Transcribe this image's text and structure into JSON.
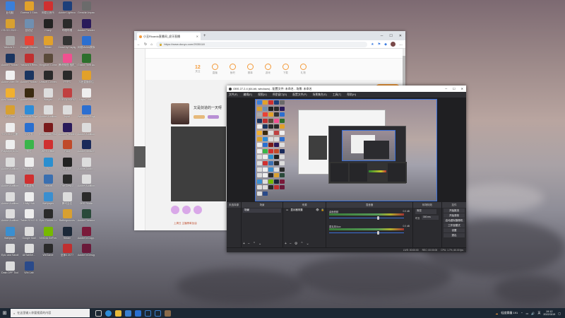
{
  "desktop_icons": [
    {
      "label": "此电脑",
      "color": "#3b7fd9"
    },
    {
      "label": "Garena 3 Global Off...",
      "color": "#e2a12a"
    },
    {
      "label": "网易云音乐",
      "color": "#d03030"
    },
    {
      "label": "Adobe Lightroom...",
      "color": "#1d3f7a"
    },
    {
      "label": "Genshin Impact",
      "color": "#6b6b6b"
    },
    {
      "label": "CS:GO 2022...",
      "color": "#d8a030"
    },
    {
      "label": "",
      "color": "transparent"
    },
    {
      "label": "",
      "color": "transparent"
    },
    {
      "label": "",
      "color": "transparent"
    },
    {
      "label": "",
      "color": "transparent"
    },
    {
      "label": "回收站",
      "color": "#6f8fb0"
    },
    {
      "label": "Crazy",
      "color": "#222"
    },
    {
      "label": "哔哩哔哩",
      "color": "#2a2a2a"
    },
    {
      "label": "Adobe Premier...",
      "color": "#2a1a5a"
    },
    {
      "label": "Yakuza 3...",
      "color": "#aaa"
    },
    {
      "label": "Google Chrome",
      "color": "#e94235"
    },
    {
      "label": "",
      "color": "transparent"
    },
    {
      "label": "",
      "color": "transparent"
    },
    {
      "label": "",
      "color": "transparent"
    },
    {
      "label": "",
      "color": "transparent"
    },
    {
      "label": "Steam",
      "color": "#e2a12a"
    },
    {
      "label": "Dead by Daylight",
      "color": "#333"
    },
    {
      "label": "网易MuMu模拟器",
      "color": "#2c6fd0"
    },
    {
      "label": "Adobe Photosh...",
      "color": "#1b3560"
    },
    {
      "label": "Yakuza 5 Remaster...",
      "color": "#c03030"
    },
    {
      "label": "Kingdom Come...",
      "color": "#5a4a3a"
    },
    {
      "label": "",
      "color": "transparent"
    },
    {
      "label": "",
      "color": "transparent"
    },
    {
      "label": "",
      "color": "transparent"
    },
    {
      "label": "",
      "color": "transparent"
    },
    {
      "label": "腾讯微视 相机工具",
      "color": "#f05090"
    },
    {
      "label": "Grand Theft Auto V",
      "color": "#2d6f2d"
    },
    {
      "label": "Adobe After Effects",
      "color": "#f0f0f0"
    },
    {
      "label": "Adobe Photoshop...",
      "color": "#1b3560"
    },
    {
      "label": "Ubisoft Connect",
      "color": "#2a2a2a"
    },
    {
      "label": "FRPS",
      "color": "#2a2a2a"
    },
    {
      "label": "",
      "color": "transparent"
    },
    {
      "label": "",
      "color": "transparent"
    },
    {
      "label": "",
      "color": "transparent"
    },
    {
      "label": "",
      "color": "transparent"
    },
    {
      "label": "抖音直播伴侣",
      "color": "#e2a12a"
    },
    {
      "label": "AdvGuardian 加速器",
      "color": "#f0b030"
    },
    {
      "label": "Adobe Illustrat...",
      "color": "#3a2a10"
    },
    {
      "label": "Wargaz",
      "color": "#ddd"
    },
    {
      "label": "FORZA HORIZON...",
      "color": "#c04040"
    },
    {
      "label": "Logic7 Vid...",
      "color": "#eee"
    },
    {
      "label": "",
      "color": "transparent"
    },
    {
      "label": "",
      "color": "transparent"
    },
    {
      "label": "",
      "color": "transparent"
    },
    {
      "label": "",
      "color": "transparent"
    },
    {
      "label": "VS Code",
      "color": "#d8a030"
    },
    {
      "label": "Microsoft Edge",
      "color": "#2d8cd8"
    },
    {
      "label": "Adobe Audition",
      "color": "#ddd"
    },
    {
      "label": "Inpal",
      "color": "#ddd"
    },
    {
      "label": "Wallpaper Engine",
      "color": "#2d6fd0"
    },
    {
      "label": "TOTOSO 加速器",
      "color": "#eee"
    },
    {
      "label": "",
      "color": "transparent"
    },
    {
      "label": "",
      "color": "transparent"
    },
    {
      "label": "",
      "color": "transparent"
    },
    {
      "label": "",
      "color": "transparent"
    },
    {
      "label": "XX文件",
      "color": "#2a6fd0"
    },
    {
      "label": "Red Dead Redemption",
      "color": "#7a1a1a"
    },
    {
      "label": "Adobe Premiere...",
      "color": "#2a1a5a"
    },
    {
      "label": "Adobe Audition...",
      "color": "#ddd"
    },
    {
      "label": "Potplayer 64 bit",
      "color": "#eee"
    },
    {
      "label": "微信",
      "color": "#3ab54a"
    },
    {
      "label": "",
      "color": "transparent"
    },
    {
      "label": "",
      "color": "transparent"
    },
    {
      "label": "",
      "color": "transparent"
    },
    {
      "label": "",
      "color": "transparent"
    },
    {
      "label": "WPS Office",
      "color": "#d03030"
    },
    {
      "label": "Rust",
      "color": "#c04a2a"
    },
    {
      "label": "Adobe Media Enc...",
      "color": "#1a2a5a"
    },
    {
      "label": "Adobe Audition",
      "color": "#ddd"
    },
    {
      "label": "Pinnacle ...",
      "color": "#eee"
    },
    {
      "label": "",
      "color": "transparent"
    },
    {
      "label": "",
      "color": "transparent"
    },
    {
      "label": "",
      "color": "transparent"
    },
    {
      "label": "",
      "color": "transparent"
    },
    {
      "label": "",
      "color": "transparent"
    },
    {
      "label": "EA",
      "color": "#2a8fd0"
    },
    {
      "label": "CULMS",
      "color": "#222"
    },
    {
      "label": "Adobe Audio...",
      "color": "#ddd"
    },
    {
      "label": "Adobe Audition",
      "color": "#ddd"
    },
    {
      "label": "网易游戏",
      "color": "#d03030"
    },
    {
      "label": "",
      "color": "transparent"
    },
    {
      "label": "",
      "color": "transparent"
    },
    {
      "label": "",
      "color": "transparent"
    },
    {
      "label": "",
      "color": "transparent"
    },
    {
      "label": "",
      "color": "transparent"
    },
    {
      "label": "Ubisoft",
      "color": "#3a6fb0"
    },
    {
      "label": "The Crew 2",
      "color": "#2a2a2a"
    },
    {
      "label": "Adobe Audition",
      "color": "#ddd"
    },
    {
      "label": "Adobe Audition",
      "color": "#ddd"
    },
    {
      "label": "Unity Hub",
      "color": "#eee"
    },
    {
      "label": "",
      "color": "transparent"
    },
    {
      "label": "",
      "color": "transparent"
    },
    {
      "label": "",
      "color": "transparent"
    },
    {
      "label": "",
      "color": "transparent"
    },
    {
      "label": "",
      "color": "transparent"
    },
    {
      "label": "Wallpaper",
      "color": "#3a8fd0"
    },
    {
      "label": "腾讯会议",
      "color": "#ddd"
    },
    {
      "label": "OBS Studio",
      "color": "#2a2a2a"
    },
    {
      "label": "Adobe Audition",
      "color": "#ddd"
    },
    {
      "label": "Tablet SOLO Digital...",
      "color": "#eee"
    },
    {
      "label": "",
      "color": "transparent"
    },
    {
      "label": "",
      "color": "transparent"
    },
    {
      "label": "",
      "color": "transparent"
    },
    {
      "label": "",
      "color": "transparent"
    },
    {
      "label": "",
      "color": "transparent"
    },
    {
      "label": "Epic Games Launcher",
      "color": "#2a2a2a"
    },
    {
      "label": "Battlegrounds",
      "color": "#d8a030"
    },
    {
      "label": "Adobe Dreamweaver",
      "color": "#2a4a3a"
    },
    {
      "label": "Wallpaper",
      "color": "#3a8fd0"
    },
    {
      "label": "Google Mail",
      "color": "#ddd"
    },
    {
      "label": "",
      "color": "transparent"
    },
    {
      "label": "",
      "color": "transparent"
    },
    {
      "label": "",
      "color": "transparent"
    },
    {
      "label": "",
      "color": "transparent"
    },
    {
      "label": "",
      "color": "transparent"
    },
    {
      "label": "NVIDIA GeForce...",
      "color": "#76b900"
    },
    {
      "label": "Steam",
      "color": "#1b2838"
    },
    {
      "label": "Adobe InCopy...",
      "color": "#7a1a3a"
    },
    {
      "label": "Epic and Sandbox",
      "color": "#ddd"
    },
    {
      "label": "AltTabSel...",
      "color": "#ddd"
    },
    {
      "label": "",
      "color": "transparent"
    },
    {
      "label": "",
      "color": "transparent"
    },
    {
      "label": "",
      "color": "transparent"
    },
    {
      "label": "",
      "color": "transparent"
    },
    {
      "label": "",
      "color": "transparent"
    },
    {
      "label": "WeGame",
      "color": "#2a2a2a"
    },
    {
      "label": "巫师3 2077",
      "color": "#c03030"
    },
    {
      "label": "Adobe InDesign",
      "color": "#6a1a3a"
    },
    {
      "label": "Dash DPF Tool",
      "color": "#ddd"
    },
    {
      "label": "Win Lab",
      "color": "#2a4a8a"
    }
  ],
  "browser": {
    "tab_title": "小丑Ricardo直播间_虎牙直播",
    "url": "https://www.douyu.com/2035118",
    "menu": [
      {
        "label": "12",
        "sub": "关注"
      },
      {
        "label": "",
        "sub": "直播"
      },
      {
        "label": "",
        "sub": "鱼吧"
      },
      {
        "label": "",
        "sub": "赛事"
      },
      {
        "label": "",
        "sub": "游戏"
      },
      {
        "label": "",
        "sub": "下载"
      },
      {
        "label": "",
        "sub": "礼物"
      }
    ],
    "login_label": "登录 | 注册",
    "room_title": "又是剑道的一天呀",
    "footer_text": "上周日 主播榜单加油"
  },
  "obs": {
    "title": "OBS 27.2.4 (64-bit, windows) - 配置文件: 未命名 - 场景: 未命名",
    "menu": [
      "文件(F)",
      "编辑(E)",
      "视图(V)",
      "停靠窗口(D)",
      "配置文件(P)",
      "场景集合(S)",
      "工具(T)",
      "帮助(H)"
    ],
    "no_source_text": "未选择源",
    "docks": {
      "scenes": {
        "header": "场景",
        "item": "场景"
      },
      "sources": {
        "header": "来源",
        "item": "显示器采集"
      },
      "mixer": {
        "header": "混音器",
        "channels": [
          {
            "name": "桌面音频",
            "db": "0.0 dB"
          },
          {
            "name": "麦克风/Aux",
            "db": "0.0 dB"
          }
        ]
      },
      "transitions": {
        "header": "转场特效",
        "selected": "渐变",
        "duration_label": "时长",
        "duration": "300 ms"
      },
      "controls": {
        "header": "控件",
        "buttons": [
          "开始推流",
          "开始录制",
          "启动虚拟摄像机",
          "工作室模式",
          "设置",
          "退出"
        ]
      }
    },
    "status": [
      "LIVE: 00:00:00",
      "REC: 00:00:00",
      "CPU: 1.7%, 60.00 fps"
    ]
  },
  "taskbar": {
    "search_placeholder": "在这里输入你要搜索的内容",
    "weather": "轻度雾霾 191",
    "ime": "英",
    "time": "19:12",
    "date": "2022/3/19"
  }
}
